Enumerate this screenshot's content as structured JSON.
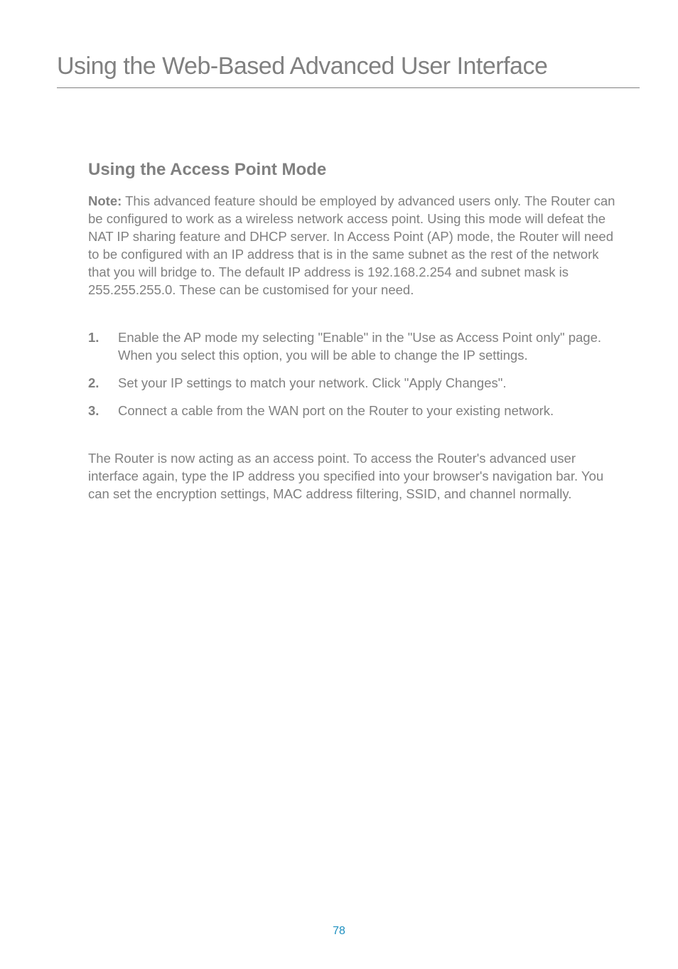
{
  "page": {
    "title": "Using the Web-Based Advanced User Interface",
    "number": "78"
  },
  "section": {
    "heading": "Using the Access Point Mode",
    "note_label": "Note:",
    "note_text": " This advanced feature should be employed by advanced users only. The Router can be configured to work as a wireless network access point. Using this mode will defeat the NAT IP sharing feature and DHCP server. In Access Point (AP) mode, the Router will need to be configured with an IP address that is in the same subnet as the rest of the network that you will bridge to. The default IP address is 192.168.2.254 and subnet mask is 255.255.255.0. These can be customised for your need."
  },
  "steps": [
    {
      "number": "1.",
      "text": "Enable the AP mode my selecting \"Enable\" in the \"Use as Access Point only\" page. When you select this option, you will be able to change the IP settings."
    },
    {
      "number": "2.",
      "text": "Set your IP settings to match your network. Click \"Apply Changes\"."
    },
    {
      "number": "3.",
      "text": "Connect a cable from the WAN port on the Router to your existing network."
    }
  ],
  "closing": "The Router is now acting as an access point. To access the Router's advanced user interface again, type the IP address you specified into your browser's navigation bar. You can set the encryption settings, MAC address filtering, SSID, and channel normally."
}
